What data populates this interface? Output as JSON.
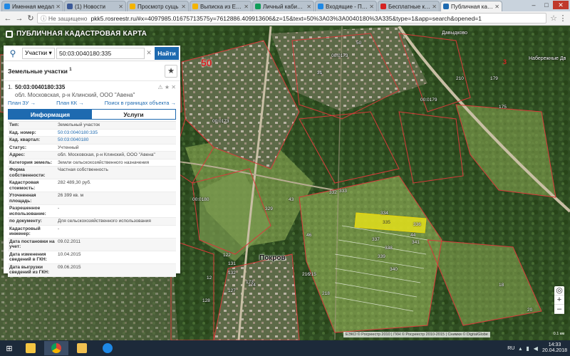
{
  "browser": {
    "tabs": [
      {
        "label": "Именная медал",
        "color": "#1e88e5",
        "active": false
      },
      {
        "label": "(1) Новости",
        "color": "#3b5998",
        "active": false
      },
      {
        "label": "Просмотр сущь",
        "color": "#f4b400",
        "active": false
      },
      {
        "label": "Выписка из ЕГР",
        "color": "#f4b400",
        "active": false
      },
      {
        "label": "Личный кабинет",
        "color": "#0f9d58",
        "active": false
      },
      {
        "label": "Входящие - Почт",
        "color": "#1e88e5",
        "active": false
      },
      {
        "label": "Бесплатные кон",
        "color": "#d62222",
        "active": false
      },
      {
        "label": "Публичная када",
        "color": "#1e6ab0",
        "active": true
      }
    ],
    "window_controls": {
      "minimize": "–",
      "maximize": "□",
      "close": "✕"
    },
    "nav": {
      "back": "←",
      "forward": "→",
      "reload": "↻"
    },
    "security_label": "ⓘ Не защищено",
    "url": "pkk5.rosreestr.ru/#x=4097985.01675713575y=7612886.409913606&z=15&text=50%3A03%3A0040180%3A335&type=1&app=search&opened=1",
    "bookmark_icon": "☆",
    "menu_icon": "⋮"
  },
  "app": {
    "title": "ПУБЛИЧНАЯ КАДАСТРОВАЯ КАРТА"
  },
  "search": {
    "icon": "🔍",
    "type_label": "Участки ▾",
    "value": "50:03:0040180:335",
    "clear": "✕",
    "button": "Найти"
  },
  "results": {
    "title": "Земельные участки",
    "count": "1",
    "fav_icon": "★",
    "item": {
      "num": "1.",
      "cad": "50:03:0040180:335",
      "addr": "обл. Московская, р-н Клинский, ООО \"Авена\"",
      "icons": "⚠ ★ ✕",
      "links": [
        "План ЗУ →",
        "План КК →",
        "Поиск в границах объекта →"
      ]
    },
    "tabs": [
      "Информация",
      "Услуги"
    ]
  },
  "properties": [
    {
      "k": "Тип:",
      "v": "Земельный участок",
      "link": false
    },
    {
      "k": "Кад. номер:",
      "v": "50:03:0040180:335",
      "link": true
    },
    {
      "k": "Кад. квартал:",
      "v": "50:03:0040180",
      "link": true
    },
    {
      "k": "Статус:",
      "v": "Учтенный",
      "link": false
    },
    {
      "k": "Адрес:",
      "v": "обл. Московская, р-н Клинский, ООО \"Авена\"",
      "link": false
    },
    {
      "k": "Категория земель:",
      "v": "Земли сельскохозяйственного назначения",
      "link": false
    },
    {
      "k": "Форма собственности:",
      "v": "Частная собственность",
      "link": false
    },
    {
      "k": "Кадастровая стоимость:",
      "v": "282 489,30 руб.",
      "link": false
    },
    {
      "k": "Уточненная площадь:",
      "v": "26 399 кв. м",
      "link": false
    },
    {
      "k": "Разрешенное использование:",
      "v": "-",
      "link": false
    },
    {
      "k": "по документу:",
      "v": "Для сельскохозяйственного использования",
      "link": false
    },
    {
      "k": "Кадастровый инженер:",
      "v": "-",
      "link": false
    },
    {
      "k": "Дата постановки на учет:",
      "v": "09.02.2011",
      "link": false
    },
    {
      "k": "Дата изменения сведений в ГКН:",
      "v": "10.04.2015",
      "link": false
    },
    {
      "k": "Дата выгрузки сведений из ГКН:",
      "v": "09.06.2015",
      "link": false
    }
  ],
  "map": {
    "region_label": "50",
    "place_name": "Покров",
    "village_1": "Давыдково",
    "village_2": "Набережные Дв",
    "red_3": "3",
    "parcel_labels": [
      "00:0173",
      "00:0173",
      "00:0179",
      "00:0180",
      "334",
      "335",
      "336",
      "337",
      "338",
      "339",
      "340",
      "341",
      "332",
      "333",
      "128",
      "127",
      "175",
      "173",
      "174",
      "216",
      "215",
      "218",
      "210",
      "179",
      "131",
      "132",
      "122",
      "50",
      "329",
      "31",
      "44",
      "12",
      "18",
      "20",
      "43",
      "46"
    ],
    "copyright": "ЕЭКО © Росреестр 2010 | ГКН © Росреестр 2010-2015 | Снимки © DigitalGlobe",
    "scale": "0.1 км",
    "zoom_in": "+",
    "zoom_out": "–",
    "locate": "◎"
  },
  "taskbar": {
    "start": "⊞",
    "items": [
      {
        "name": "folder",
        "color": "#f4c542"
      },
      {
        "name": "chrome",
        "color": "#0f9d58"
      },
      {
        "name": "explorer",
        "color": "#f0c050"
      },
      {
        "name": "ie",
        "color": "#1e88e5"
      }
    ],
    "lang": "RU",
    "time": "14:33",
    "date": "20.04.2018"
  }
}
